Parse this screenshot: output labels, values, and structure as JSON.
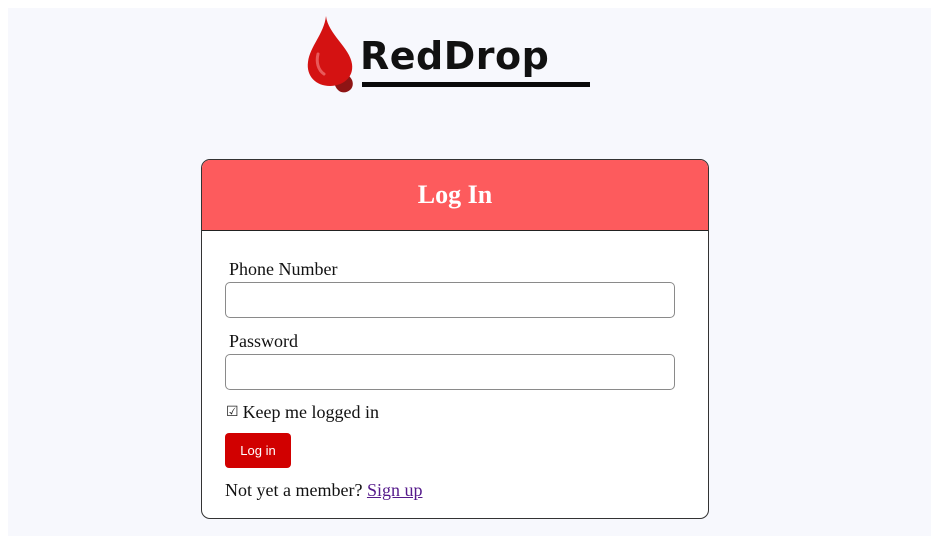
{
  "brand": {
    "name": "RedDrop",
    "logo_icon": "blood-drop-icon",
    "colors": {
      "drop_primary": "#d41212",
      "drop_shadow": "#8e1414"
    }
  },
  "login_card": {
    "title": "Log In",
    "header_color": "#fd5b5d",
    "phone": {
      "label": "Phone Number",
      "value": "",
      "placeholder": ""
    },
    "password": {
      "label": "Password",
      "value": "",
      "placeholder": ""
    },
    "keep_logged_in": {
      "icon": "checkbox-icon",
      "label": "Keep me logged in"
    },
    "submit_label": "Log in",
    "submit_color": "#d10000",
    "signup_prompt": "Not yet a member?",
    "signup_link": "Sign up"
  }
}
